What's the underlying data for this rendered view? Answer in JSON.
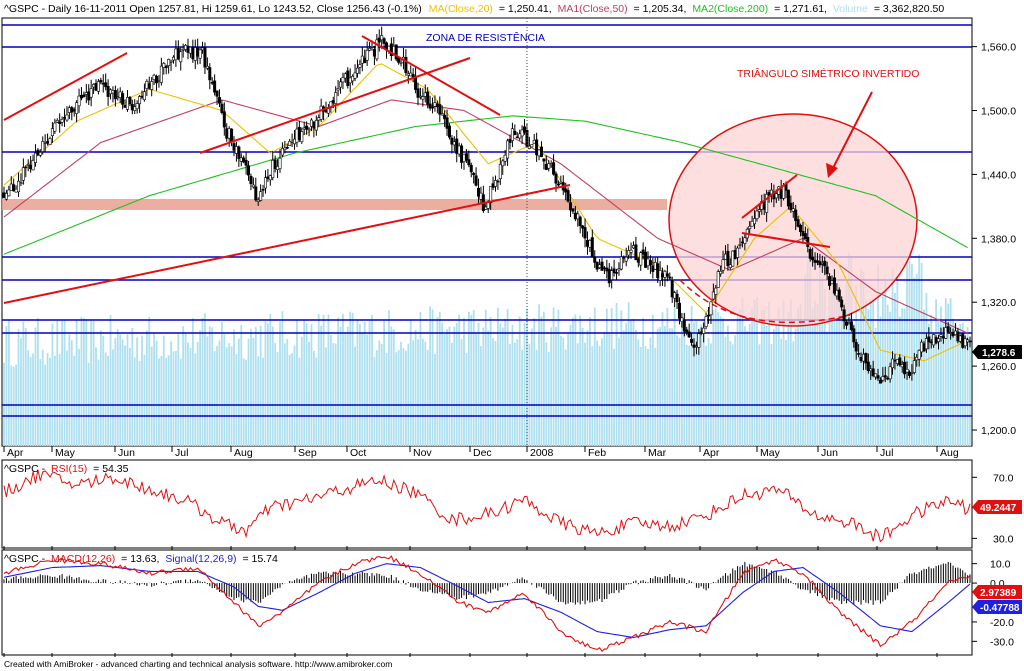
{
  "app": {
    "footer": "Created with AmiBroker - advanced charting and technical analysis software. http://www.amibroker.com"
  },
  "price_header": {
    "main": "^GSPC - Daily 16-11-2011 Open 1257.81, Hi 1259.61, Lo 1243.52, Close 1256.43 (-0.1%)",
    "ma20_label": "MA(Close,20)",
    "ma20_value": "= 1,250.41,",
    "ma50_label": "MA1(Close,50)",
    "ma50_value": "= 1,205.34,",
    "ma200_label": "MA2(Close,200)",
    "ma200_value": "= 1,271.61,",
    "volume_label": "Volume",
    "volume_value": "= 3,362,820.50"
  },
  "annotations": {
    "resistance_zone": "ZONA DE RESISTÊNCIA",
    "triangle": "TRIÂNGULO SIMÉTRICO INVERTIDO"
  },
  "rsi_header": {
    "prefix": "^GSPC -",
    "label": "RSI(15)",
    "value": "= 54.35"
  },
  "macd_header": {
    "prefix": "^GSPC -",
    "macd_label": "MACD(12,26)",
    "macd_value": "= 13.63,",
    "signal_label": "Signal(12,26,9)",
    "signal_value": "= 15.74"
  },
  "colors": {
    "candle": "#000000",
    "ma20": "#f0c000",
    "ma50": "#c04060",
    "ma200": "#20c020",
    "volume": "#aee0f0",
    "trendline": "#e01010",
    "horizontal": "#0000c0",
    "resistance_band": "#e8a090",
    "circle_fill": "#fcd4d4",
    "rsi": "#e01010",
    "macd": "#e01010",
    "signal": "#2020e0",
    "hist": "#000000",
    "last_price_tag": "#000000",
    "rsi_tag": "#e01010",
    "macd_tag": "#e01010",
    "signal_tag": "#2020e0"
  },
  "chart_data": [
    {
      "type": "candlestick",
      "x_tick_labels": [
        "Apr",
        "May",
        "Jun",
        "Jul",
        "Aug",
        "Sep",
        "Oct",
        "Nov",
        "Dec",
        "2008",
        "Feb",
        "Mar",
        "Apr",
        "May",
        "Jun",
        "Jul",
        "Aug"
      ],
      "y_ticks": [
        1200,
        1260,
        1320,
        1380,
        1440,
        1500,
        1560
      ],
      "y_tick_labels": [
        "1,200.0",
        "1,260.0",
        "1,320.0",
        "1,380.0",
        "1,440.0",
        "1,500.0",
        "1,560.0"
      ],
      "ylim": [
        1185,
        1585
      ],
      "last_price_label": "1,278.6",
      "last_price": 1278.6,
      "price_path": [
        [
          0,
          1420
        ],
        [
          8,
          1440
        ],
        [
          20,
          1480
        ],
        [
          32,
          1510
        ],
        [
          40,
          1525
        ],
        [
          52,
          1505
        ],
        [
          62,
          1530
        ],
        [
          72,
          1555
        ],
        [
          82,
          1555
        ],
        [
          92,
          1480
        ],
        [
          100,
          1450
        ],
        [
          104,
          1415
        ],
        [
          110,
          1445
        ],
        [
          118,
          1470
        ],
        [
          128,
          1490
        ],
        [
          138,
          1520
        ],
        [
          148,
          1545
        ],
        [
          156,
          1565
        ],
        [
          164,
          1550
        ],
        [
          170,
          1520
        ],
        [
          178,
          1505
        ],
        [
          186,
          1470
        ],
        [
          192,
          1445
        ],
        [
          198,
          1410
        ],
        [
          204,
          1440
        ],
        [
          210,
          1480
        ],
        [
          218,
          1470
        ],
        [
          226,
          1445
        ],
        [
          232,
          1420
        ],
        [
          238,
          1395
        ],
        [
          244,
          1360
        ],
        [
          250,
          1345
        ],
        [
          258,
          1370
        ],
        [
          266,
          1355
        ],
        [
          274,
          1345
        ],
        [
          280,
          1300
        ],
        [
          286,
          1280
        ],
        [
          290,
          1305
        ],
        [
          296,
          1355
        ],
        [
          302,
          1365
        ],
        [
          308,
          1395
        ],
        [
          316,
          1420
        ],
        [
          322,
          1425
        ],
        [
          328,
          1395
        ],
        [
          334,
          1360
        ],
        [
          340,
          1345
        ],
        [
          346,
          1315
        ],
        [
          352,
          1280
        ],
        [
          358,
          1255
        ],
        [
          362,
          1240
        ],
        [
          368,
          1265
        ],
        [
          374,
          1255
        ],
        [
          380,
          1280
        ],
        [
          386,
          1290
        ],
        [
          392,
          1290
        ],
        [
          399,
          1278
        ]
      ],
      "ma20": [
        [
          0,
          1430
        ],
        [
          30,
          1490
        ],
        [
          60,
          1520
        ],
        [
          90,
          1500
        ],
        [
          110,
          1460
        ],
        [
          130,
          1485
        ],
        [
          155,
          1545
        ],
        [
          175,
          1520
        ],
        [
          200,
          1450
        ],
        [
          220,
          1470
        ],
        [
          245,
          1380
        ],
        [
          270,
          1355
        ],
        [
          290,
          1310
        ],
        [
          310,
          1380
        ],
        [
          325,
          1410
        ],
        [
          345,
          1355
        ],
        [
          362,
          1275
        ],
        [
          380,
          1265
        ],
        [
          399,
          1285
        ]
      ],
      "ma50": [
        [
          0,
          1400
        ],
        [
          40,
          1470
        ],
        [
          90,
          1510
        ],
        [
          130,
          1485
        ],
        [
          160,
          1510
        ],
        [
          190,
          1500
        ],
        [
          230,
          1450
        ],
        [
          270,
          1380
        ],
        [
          300,
          1350
        ],
        [
          330,
          1380
        ],
        [
          360,
          1330
        ],
        [
          399,
          1290
        ]
      ],
      "ma200": [
        [
          0,
          1365
        ],
        [
          60,
          1420
        ],
        [
          120,
          1460
        ],
        [
          170,
          1485
        ],
        [
          210,
          1495
        ],
        [
          240,
          1490
        ],
        [
          280,
          1470
        ],
        [
          320,
          1445
        ],
        [
          360,
          1420
        ],
        [
          399,
          1370
        ]
      ],
      "volume_bars": 400
    },
    {
      "type": "line",
      "series": [
        {
          "name": "RSI(15)"
        }
      ],
      "y_ticks": [
        30,
        70
      ],
      "y_tick_labels": [
        "30.0",
        "70.0"
      ],
      "ylim": [
        25,
        80
      ],
      "last_value_label": "49.2447",
      "path": [
        [
          0,
          60
        ],
        [
          15,
          72
        ],
        [
          30,
          65
        ],
        [
          45,
          70
        ],
        [
          60,
          62
        ],
        [
          75,
          55
        ],
        [
          90,
          40
        ],
        [
          100,
          35
        ],
        [
          110,
          50
        ],
        [
          125,
          55
        ],
        [
          140,
          62
        ],
        [
          155,
          68
        ],
        [
          170,
          60
        ],
        [
          185,
          42
        ],
        [
          200,
          46
        ],
        [
          215,
          55
        ],
        [
          230,
          40
        ],
        [
          245,
          33
        ],
        [
          260,
          40
        ],
        [
          275,
          38
        ],
        [
          290,
          45
        ],
        [
          305,
          58
        ],
        [
          320,
          62
        ],
        [
          335,
          45
        ],
        [
          350,
          40
        ],
        [
          362,
          30
        ],
        [
          375,
          45
        ],
        [
          390,
          55
        ],
        [
          399,
          49
        ]
      ]
    },
    {
      "type": "line",
      "series": [
        {
          "name": "MACD(12,26)"
        },
        {
          "name": "Signal(12,26,9)"
        }
      ],
      "y_ticks": [
        -30,
        -20,
        0,
        10
      ],
      "y_tick_labels": [
        "-30.0",
        "-20.0",
        "0.0",
        "10.0"
      ],
      "ylim": [
        -36,
        16
      ],
      "macd_last_label": "2.97389",
      "signal_last_label": "-0.47788",
      "macd_path": [
        [
          0,
          5
        ],
        [
          20,
          12
        ],
        [
          40,
          10
        ],
        [
          60,
          5
        ],
        [
          80,
          8
        ],
        [
          95,
          -10
        ],
        [
          105,
          -22
        ],
        [
          115,
          -15
        ],
        [
          130,
          0
        ],
        [
          145,
          10
        ],
        [
          158,
          14
        ],
        [
          172,
          5
        ],
        [
          188,
          -10
        ],
        [
          200,
          -15
        ],
        [
          215,
          -5
        ],
        [
          230,
          -25
        ],
        [
          245,
          -35
        ],
        [
          260,
          -28
        ],
        [
          275,
          -20
        ],
        [
          290,
          -25
        ],
        [
          305,
          5
        ],
        [
          318,
          12
        ],
        [
          330,
          5
        ],
        [
          345,
          -15
        ],
        [
          362,
          -32
        ],
        [
          375,
          -20
        ],
        [
          390,
          0
        ],
        [
          399,
          3
        ]
      ],
      "signal_path": [
        [
          0,
          3
        ],
        [
          20,
          8
        ],
        [
          40,
          9
        ],
        [
          60,
          6
        ],
        [
          80,
          6
        ],
        [
          95,
          -2
        ],
        [
          105,
          -12
        ],
        [
          115,
          -14
        ],
        [
          130,
          -5
        ],
        [
          145,
          5
        ],
        [
          158,
          10
        ],
        [
          172,
          8
        ],
        [
          188,
          -2
        ],
        [
          200,
          -10
        ],
        [
          215,
          -8
        ],
        [
          230,
          -15
        ],
        [
          245,
          -25
        ],
        [
          260,
          -28
        ],
        [
          275,
          -24
        ],
        [
          290,
          -22
        ],
        [
          305,
          -5
        ],
        [
          318,
          6
        ],
        [
          330,
          8
        ],
        [
          345,
          -5
        ],
        [
          362,
          -22
        ],
        [
          375,
          -25
        ],
        [
          390,
          -10
        ],
        [
          399,
          -0.5
        ]
      ]
    }
  ]
}
